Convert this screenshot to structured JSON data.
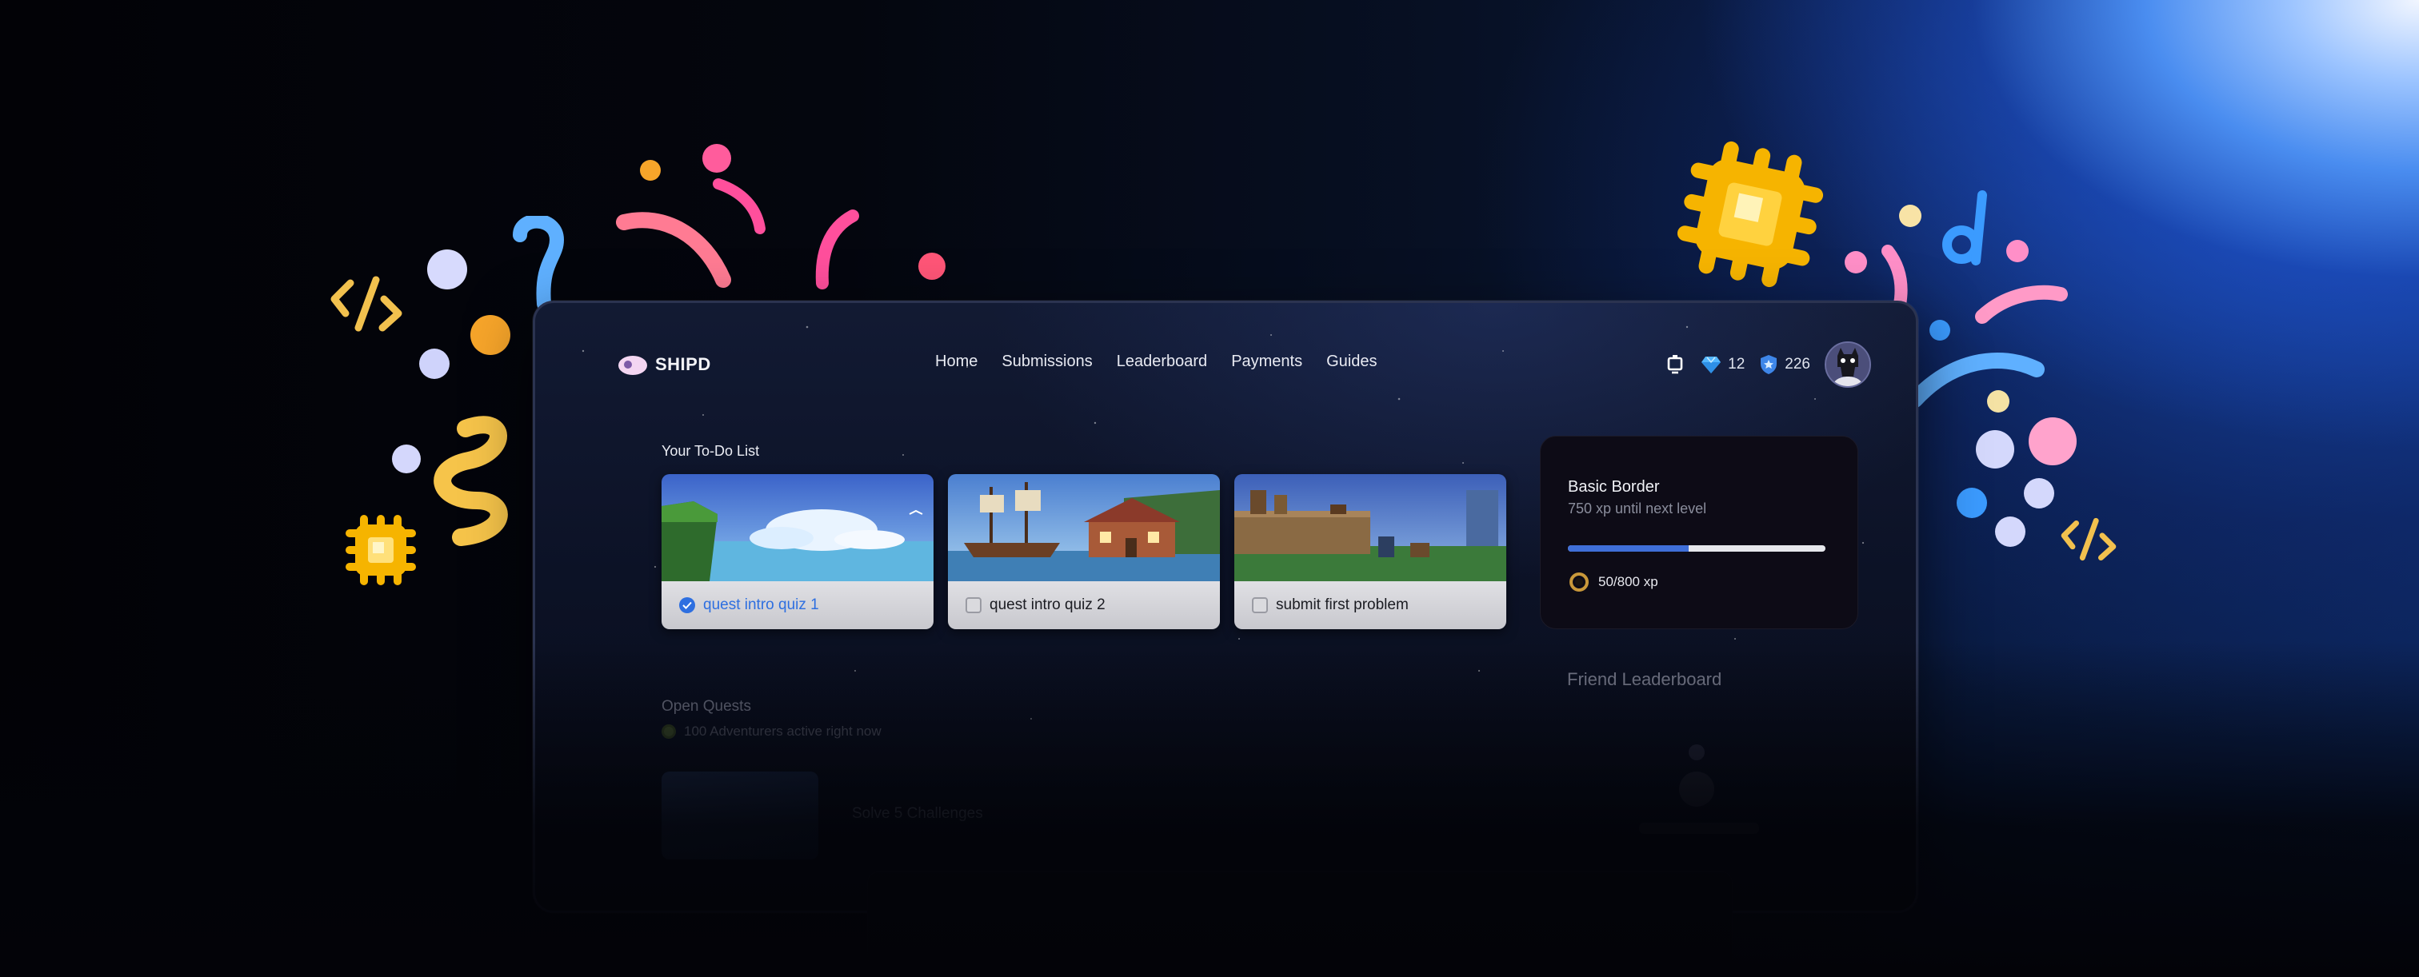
{
  "brand": {
    "name": "SHIPD"
  },
  "nav": {
    "items": [
      "Home",
      "Submissions",
      "Leaderboard",
      "Payments",
      "Guides"
    ]
  },
  "stats": {
    "gems": "12",
    "shield": "226"
  },
  "todo": {
    "title": "Your To-Do List",
    "items": [
      {
        "label": "quest intro quiz 1",
        "completed": true
      },
      {
        "label": "quest intro quiz 2",
        "completed": false
      },
      {
        "label": "submit first problem",
        "completed": false
      }
    ]
  },
  "level": {
    "title": "Basic Border",
    "subtitle": "750 xp until next level",
    "xp_text": "50/800 xp",
    "progress_fraction": 0.47
  },
  "open_quests": {
    "title": "Open Quests",
    "active_text": "100 Adventurers active right now",
    "first_quest": "Solve 5 Challenges"
  },
  "friends": {
    "title": "Friend Leaderboard"
  },
  "colors": {
    "accent": "#2e6fe0",
    "progress": "#3f6fd8",
    "background": "#0c1226"
  },
  "icons": [
    "shipd-logo-icon",
    "notification-icon",
    "gem-icon",
    "shield-icon",
    "check-icon",
    "xp-ring-icon",
    "code-icon",
    "chip-icon"
  ]
}
